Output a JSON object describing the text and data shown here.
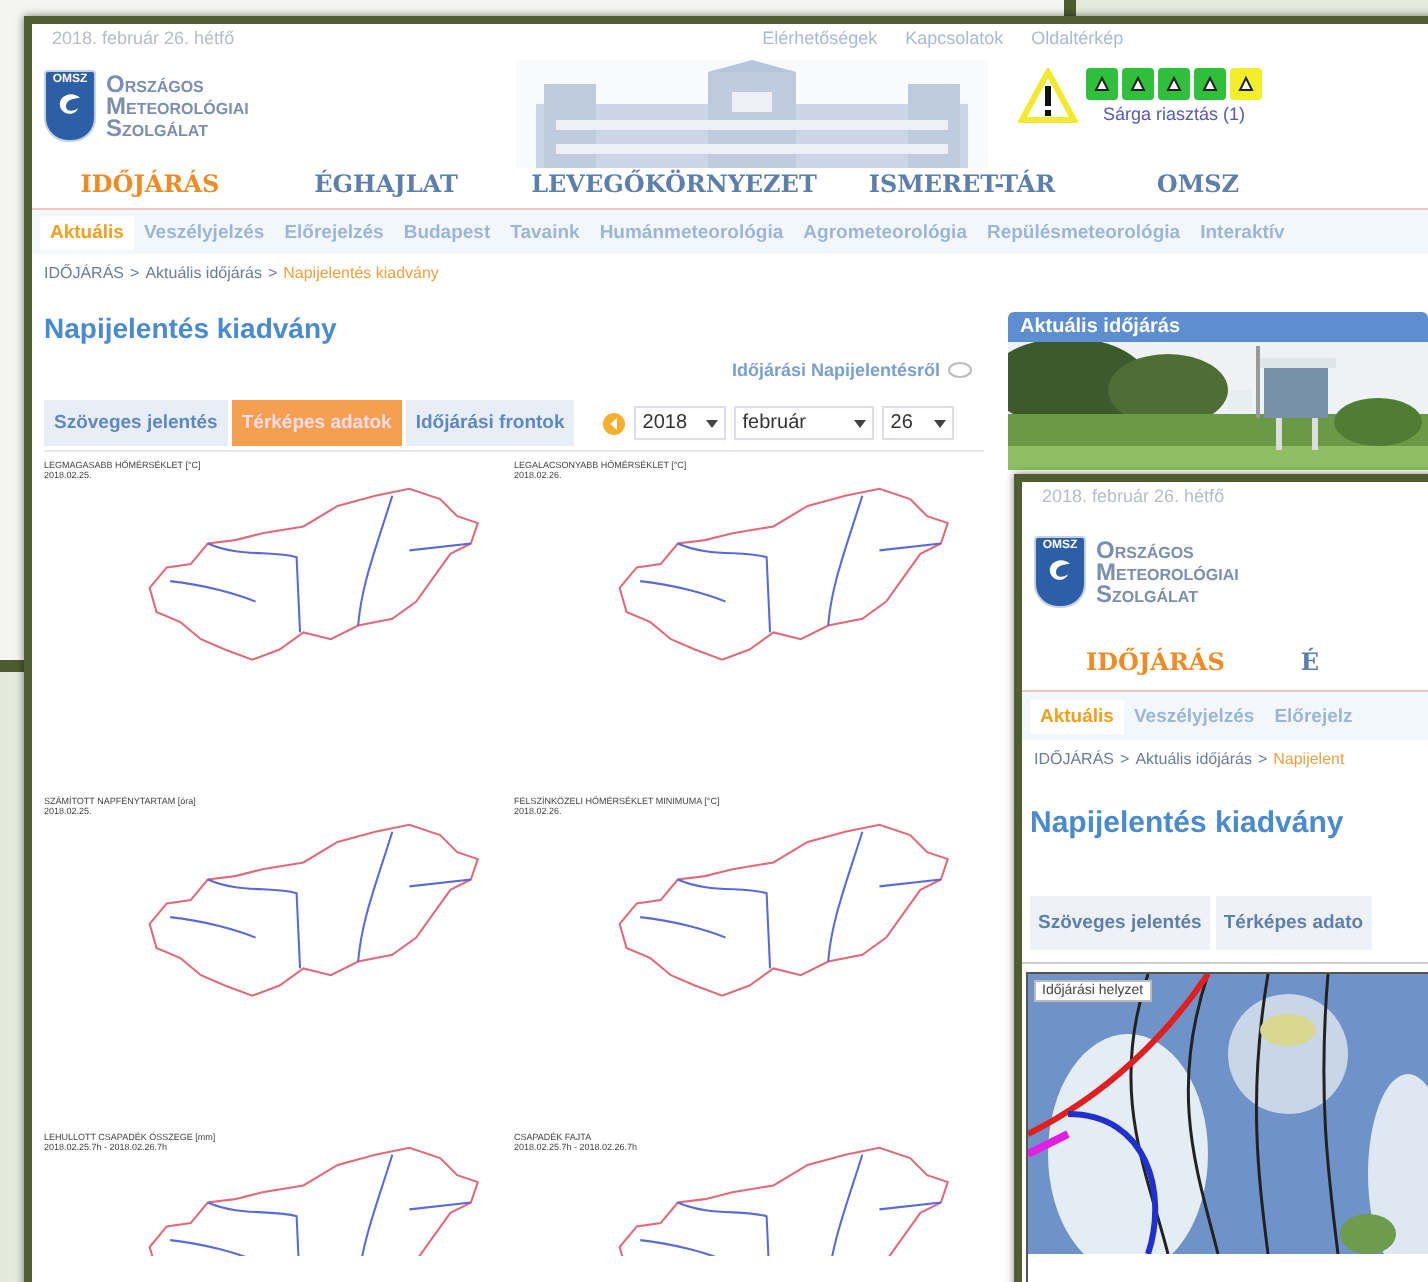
{
  "main_window": {
    "date": "2018. február 26. hétfő",
    "top_links": [
      "Elérhetőségek",
      "Kapcsolatok",
      "Oldaltérkép"
    ],
    "logo": {
      "badge": "OMSZ",
      "lines": [
        "Országos",
        "Meteorológiai",
        "Szolgálat"
      ]
    },
    "alert": {
      "label": "Sárga riasztás (1)",
      "icons": [
        {
          "color": "#2fbf3a"
        },
        {
          "color": "#2fbf3a"
        },
        {
          "color": "#2fbf3a"
        },
        {
          "color": "#2fbf3a"
        },
        {
          "color": "#f2ef2a"
        }
      ]
    },
    "nav": [
      {
        "label": "IDŐJÁRÁS",
        "selected": true
      },
      {
        "label": "ÉGHAJLAT",
        "selected": false
      },
      {
        "label": "LEVEGŐKÖRNYEZET",
        "selected": false
      },
      {
        "label": "ISMERET-TÁR",
        "selected": false
      },
      {
        "label": "OMSZ",
        "selected": false
      }
    ],
    "subnav": [
      {
        "label": "Aktuális",
        "selected": true
      },
      {
        "label": "Veszélyjelzés",
        "selected": false
      },
      {
        "label": "Előrejelzés",
        "selected": false
      },
      {
        "label": "Budapest",
        "selected": false
      },
      {
        "label": "Tavaink",
        "selected": false
      },
      {
        "label": "Humánmeteorológia",
        "selected": false
      },
      {
        "label": "Agrometeorológia",
        "selected": false
      },
      {
        "label": "Repülésmeteorológia",
        "selected": false
      },
      {
        "label": "Interaktív",
        "selected": false
      }
    ],
    "breadcrumb_separator": ">",
    "breadcrumb": [
      {
        "label": "IDŐJÁRÁS",
        "current": false
      },
      {
        "label": "Aktuális időjárás",
        "current": false
      },
      {
        "label": "Napijelentés kiadvány",
        "current": true
      }
    ],
    "page_title": "Napijelentés kiadvány",
    "about_link": "Időjárási Napijelentésről",
    "tabs": [
      {
        "label": "Szöveges jelentés",
        "selected": false
      },
      {
        "label": "Térképes adatok",
        "selected": true
      },
      {
        "label": "Időjárási frontok",
        "selected": false
      }
    ],
    "date_select": {
      "year": "2018",
      "month": "február",
      "day": "26"
    },
    "maps": [
      {
        "title": "LEGMAGASABB HŐMÉRSÉKLET [°C]",
        "date": "2018.02.25."
      },
      {
        "title": "LEGALACSONYABB HŐMÉRSÉKLET [°C]",
        "date": "2018.02.26."
      },
      {
        "title": "SZÁMÍTOTT NAPFÉNYTARTAM [óra]",
        "date": "2018.02.25."
      },
      {
        "title": "FELSZÍNKÖZELI HŐMÉRSÉKLET MINIMUMA [°C]",
        "date": "2018.02.26."
      },
      {
        "title": "LEHULLOTT CSAPADÉK ÖSSZEGE [mm]",
        "date": "2018.02.25.7h - 2018.02.26.7h"
      },
      {
        "title": "CSAPADÉK FAJTA",
        "date": "2018.02.25.7h - 2018.02.26.7h"
      }
    ],
    "side_panel": {
      "title": "Aktuális időjárás"
    }
  },
  "front_window": {
    "date": "2018. február 26. hétfő",
    "logo": {
      "badge": "OMSZ",
      "lines": [
        "Országos",
        "Meteorológiai",
        "Szolgálat"
      ]
    },
    "nav": [
      {
        "label": "IDŐJÁRÁS",
        "selected": true
      },
      {
        "label": "É",
        "selected": false
      }
    ],
    "subnav": [
      {
        "label": "Aktuális",
        "selected": true
      },
      {
        "label": "Veszélyjelzés",
        "selected": false
      },
      {
        "label": "Előrejelz",
        "selected": false
      }
    ],
    "breadcrumb_separator": ">",
    "breadcrumb": [
      {
        "label": "IDŐJÁRÁS",
        "current": false
      },
      {
        "label": "Aktuális időjárás",
        "current": false
      },
      {
        "label": "Napijelent",
        "current": true
      }
    ],
    "page_title": "Napijelentés kiadvány",
    "tabs": [
      {
        "label": "Szöveges jelentés",
        "selected": false
      },
      {
        "label": "Térképes adato",
        "selected": false
      }
    ],
    "map_label": "Időjárási helyzet"
  }
}
